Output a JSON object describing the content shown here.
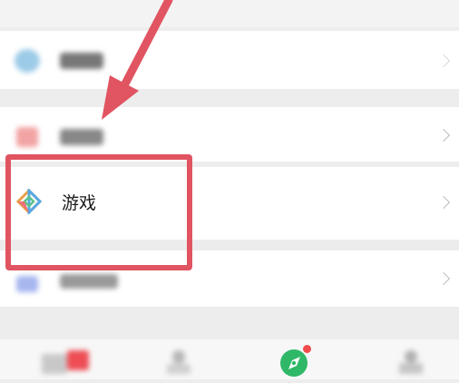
{
  "list": {
    "items": [
      {
        "label": "",
        "icon": "blurred-app-icon"
      },
      {
        "label": "",
        "icon": "blurred-app-icon"
      },
      {
        "label": "游戏",
        "icon": "game-icon"
      },
      {
        "label": "",
        "icon": "blurred-app-icon"
      }
    ]
  },
  "bottom_nav": {
    "items": [
      {
        "icon": "chats-icon"
      },
      {
        "icon": "contacts-icon"
      },
      {
        "icon": "discover-icon",
        "badge": true
      },
      {
        "icon": "me-icon"
      }
    ]
  },
  "annotation": {
    "arrow_color": "#e15461",
    "highlight_color": "#e15461"
  }
}
